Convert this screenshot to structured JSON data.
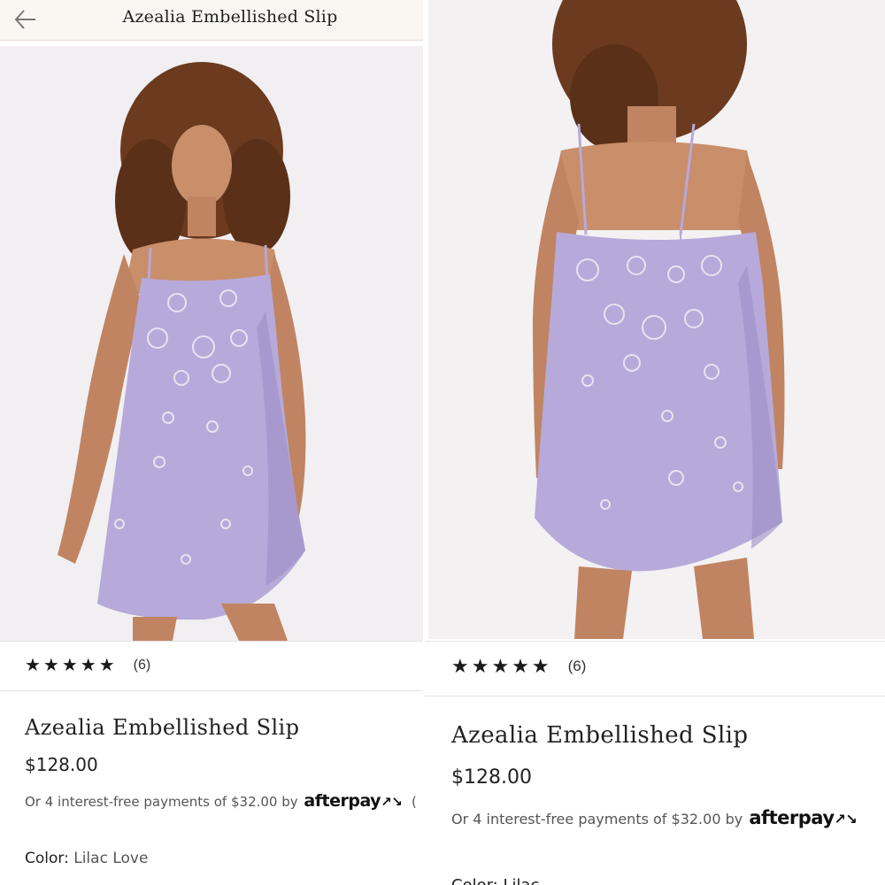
{
  "header": {
    "title": "Azealia Embellished Slip",
    "back_icon": "arrow-left-icon"
  },
  "left": {
    "rating_stars": "★★★★★",
    "rating_count": "(6)",
    "product_title": "Azealia Embellished Slip",
    "price": "$128.00",
    "installments_text": "Or 4 interest-free payments of $32.00 by",
    "afterpay_label": "afterpay",
    "afterpay_mark": "↗↘",
    "info_paren": "(",
    "color_label": "Color:",
    "color_value": "Lilac Love"
  },
  "right": {
    "rating_stars": "★★★★★",
    "rating_count": "(6)",
    "product_title": "Azealia Embellished Slip",
    "price": "$128.00",
    "installments_text": "Or 4 interest-free payments of $32.00 by",
    "afterpay_label": "afterpay",
    "afterpay_mark": "↗↘",
    "color_partial": "Color: Lilac"
  },
  "colors": {
    "dress": "#b7a9d9",
    "dress_shadow": "#9d8fc4",
    "hair": "#6b3a1f",
    "skin": "#c98e6a",
    "accent_header_bg": "#faf6f2",
    "afterpay_mark": "#3ec9b4"
  }
}
